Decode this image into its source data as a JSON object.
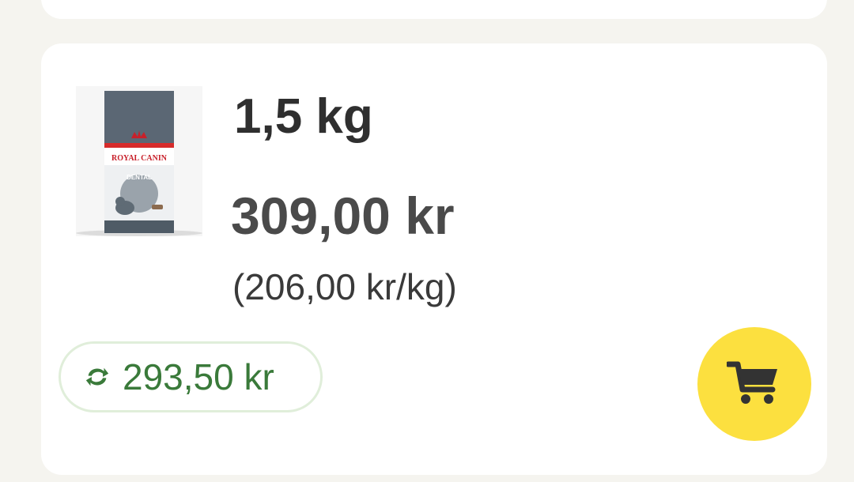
{
  "product": {
    "image_alt": "Royal Canin Dental",
    "brand_text": "ROYAL CANIN",
    "variant_text": "DENTAL",
    "size": "1,5 kg",
    "price": "309,00 kr",
    "unit_price": "(206,00 kr/kg)"
  },
  "subscription": {
    "icon": "sync-icon",
    "price": "293,50 kr",
    "color": "#3a7a3a"
  },
  "cart": {
    "icon": "cart-icon",
    "background": "#fce03f"
  }
}
